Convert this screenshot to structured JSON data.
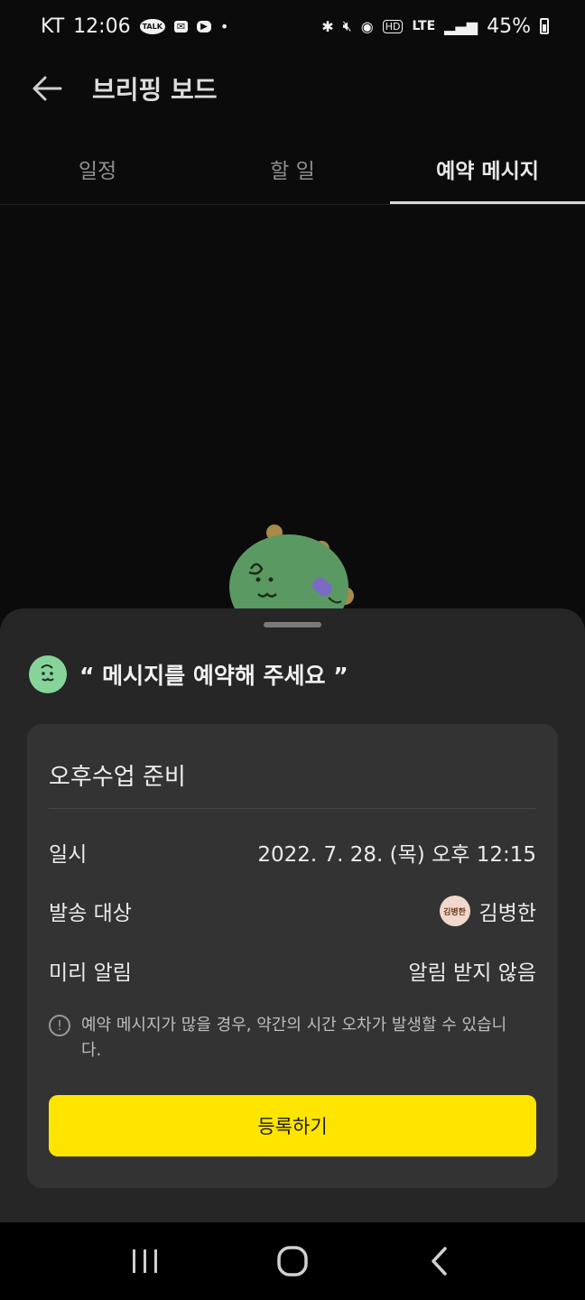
{
  "status_bar": {
    "carrier": "KT",
    "time": "12:06",
    "talk_icon_label": "TALK",
    "network": "LTE",
    "battery": "45%"
  },
  "header": {
    "title": "브리핑 보드"
  },
  "tabs": [
    {
      "label": "일정",
      "active": false
    },
    {
      "label": "할 일",
      "active": false
    },
    {
      "label": "예약 메시지",
      "active": true
    }
  ],
  "sheet": {
    "heading": "“ 메시지를 예약해 주세요 ”",
    "message_title": "오후수업 준비",
    "rows": [
      {
        "label": "일시",
        "value": "2022. 7. 28. (목) 오후 12:15"
      },
      {
        "label": "발송 대상",
        "value": "김병한",
        "avatar_text": "김병한"
      },
      {
        "label": "미리 알림",
        "value": "알림 받지 않음"
      }
    ],
    "notice": "예약 메시지가 많을 경우, 약간의 시간 오차가 발생할 수 있습니다.",
    "register_label": "등록하기"
  },
  "colors": {
    "accent_yellow": "#fde500",
    "sheet_bg": "#262626",
    "card_bg": "#333333",
    "mascot_green": "#5a9a62"
  }
}
